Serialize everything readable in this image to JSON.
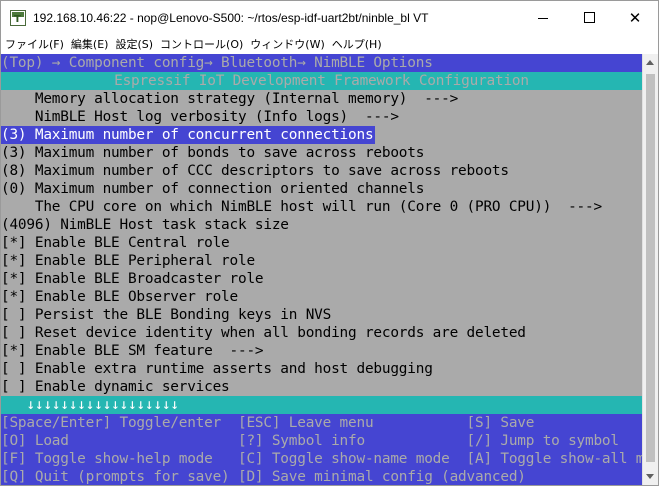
{
  "window": {
    "title": "192.168.10.46:22 - nop@Lenovo-S500: ~/rtos/esp-idf-uart2bt/ninble_bl VT",
    "minimize": "",
    "maximize": "",
    "close": "✕"
  },
  "menu": [
    "ファイル(F)",
    "編集(E)",
    "設定(S)",
    "コントロール(O)",
    "ウィンドウ(W)",
    "ヘルプ(H)"
  ],
  "terminal": {
    "breadcrumb": "(Top) → Component config→ Bluetooth→ NimBLE Options",
    "header": "Espressif IoT Development Framework Configuration",
    "lines": [
      "    Memory allocation strategy (Internal memory)  --->",
      "    NimBLE Host log verbosity (Info logs)  --->",
      "(3) Maximum number of concurrent connections",
      "(3) Maximum number of bonds to save across reboots",
      "(8) Maximum number of CCC descriptors to save across reboots",
      "(0) Maximum number of connection oriented channels",
      "    The CPU core on which NimBLE host will run (Core 0 (PRO CPU))  --->",
      "(4096) NimBLE Host task stack size",
      "[*] Enable BLE Central role",
      "[*] Enable BLE Peripheral role",
      "[*] Enable BLE Broadcaster role",
      "[*] Enable BLE Observer role",
      "[ ] Persist the BLE Bonding keys in NVS",
      "[ ] Reset device identity when all bonding records are deleted",
      "[*] Enable BLE SM feature  --->",
      "[ ] Enable extra runtime asserts and host debugging",
      "[ ] Enable dynamic services"
    ],
    "selected_index": 2,
    "scroll_indicator": "   ↓↓↓↓↓↓↓↓↓↓↓↓↓↓↓↓↓↓",
    "help": [
      "[Space/Enter] Toggle/enter  [ESC] Leave menu           [S] Save",
      "[O] Load                    [?] Symbol info            [/] Jump to symbol",
      "[F] Toggle show-help mode   [C] Toggle show-name mode  [A] Toggle show-all mode",
      "[Q] Quit (prompts for save) [D] Save minimal config (advanced)"
    ]
  },
  "colors": {
    "terminal_bg": "#aaaaaa",
    "blue": "#4545d2",
    "cyan": "#25b6b2"
  }
}
